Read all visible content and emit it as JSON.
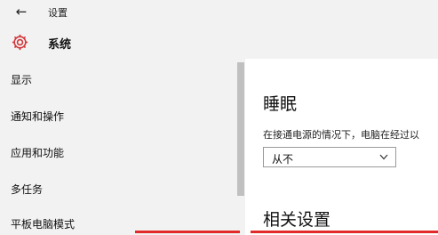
{
  "window": {
    "title": "设置"
  },
  "header": {
    "title": "系统",
    "icon": "gear-icon"
  },
  "sidebar": {
    "items": [
      {
        "label": "显示"
      },
      {
        "label": "通知和操作"
      },
      {
        "label": "应用和功能"
      },
      {
        "label": "多任务"
      },
      {
        "label": "平板电脑模式"
      }
    ]
  },
  "main": {
    "sleep": {
      "title": "睡眠",
      "description": "在接通电源的情况下，电脑在经过以",
      "dropdown_value": "从不"
    },
    "related": {
      "title": "相关设置"
    }
  },
  "colors": {
    "accent": "#d13438",
    "annotation": "#e32a2a",
    "sidebar_bg": "#f2f2f2"
  }
}
